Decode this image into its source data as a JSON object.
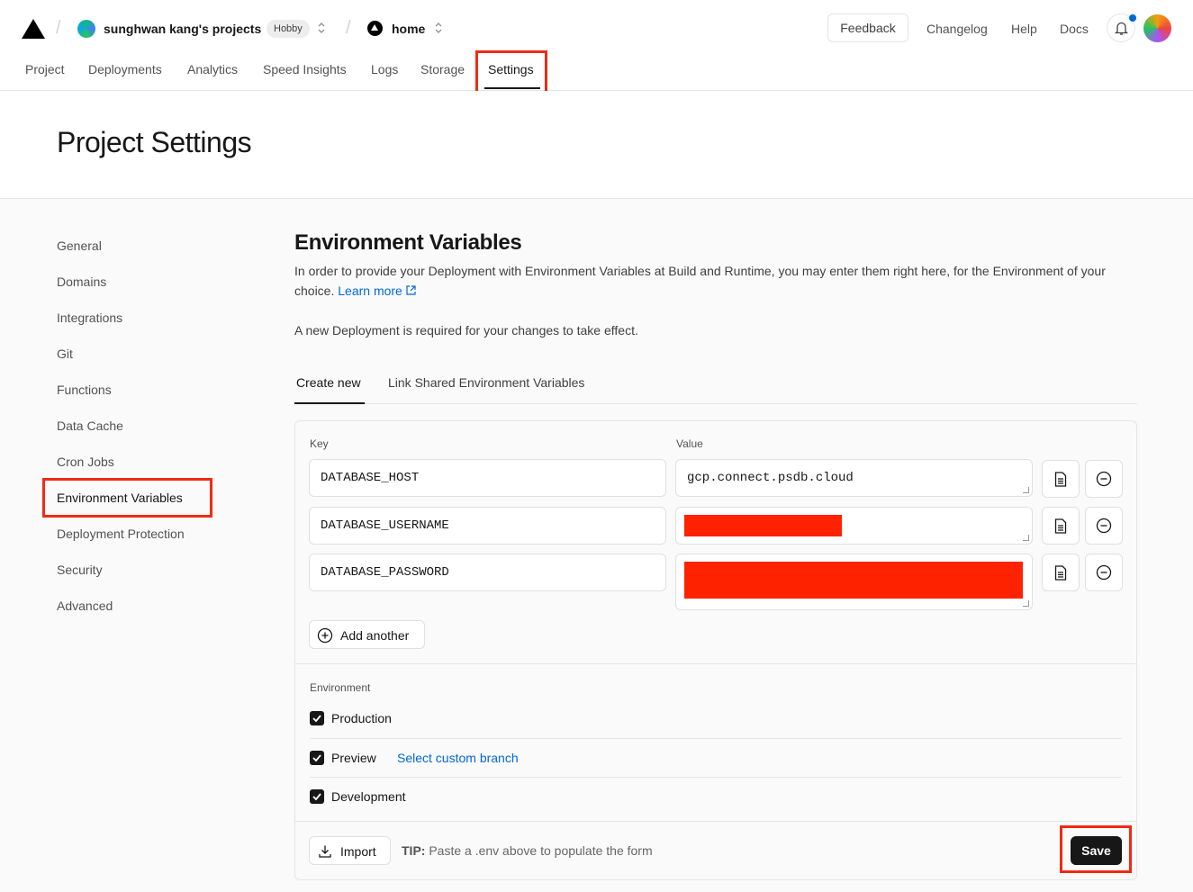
{
  "topbar": {
    "team_name": "sunghwan kang's projects",
    "team_plan": "Hobby",
    "project_name": "home",
    "feedback_label": "Feedback",
    "links": [
      "Changelog",
      "Help",
      "Docs"
    ]
  },
  "nav_tabs": [
    {
      "label": "Project"
    },
    {
      "label": "Deployments"
    },
    {
      "label": "Analytics"
    },
    {
      "label": "Speed Insights"
    },
    {
      "label": "Logs"
    },
    {
      "label": "Storage"
    },
    {
      "label": "Settings",
      "active": true
    }
  ],
  "page_title": "Project Settings",
  "sidebar": {
    "items": [
      {
        "label": "General"
      },
      {
        "label": "Domains"
      },
      {
        "label": "Integrations"
      },
      {
        "label": "Git"
      },
      {
        "label": "Functions"
      },
      {
        "label": "Data Cache"
      },
      {
        "label": "Cron Jobs"
      },
      {
        "label": "Environment Variables",
        "active": true
      },
      {
        "label": "Deployment Protection"
      },
      {
        "label": "Security"
      },
      {
        "label": "Advanced"
      }
    ]
  },
  "env": {
    "title": "Environment Variables",
    "description": "In order to provide your Deployment with Environment Variables at Build and Runtime, you may enter them right here, for the Environment of your choice.",
    "learn_more": "Learn more",
    "notice": "A new Deployment is required for your changes to take effect.",
    "subtabs": [
      "Create new",
      "Link Shared Environment Variables"
    ],
    "key_label": "Key",
    "value_label": "Value",
    "rows": [
      {
        "key": "DATABASE_HOST",
        "value": "gcp.connect.psdb.cloud",
        "redacted": false
      },
      {
        "key": "DATABASE_USERNAME",
        "value": "",
        "redacted": true
      },
      {
        "key": "DATABASE_PASSWORD",
        "value": "",
        "redacted": true
      }
    ],
    "add_another": "Add another",
    "environment_label": "Environment",
    "environments": [
      {
        "label": "Production",
        "checked": true
      },
      {
        "label": "Preview",
        "checked": true,
        "link": "Select custom branch"
      },
      {
        "label": "Development",
        "checked": true
      }
    ],
    "import_label": "Import",
    "tip_label": "TIP:",
    "tip_text": " Paste a .env above to populate the form",
    "save_label": "Save"
  },
  "colors": {
    "highlight": "#f02a14",
    "redaction": "#ff2200",
    "link": "#0068d6"
  }
}
